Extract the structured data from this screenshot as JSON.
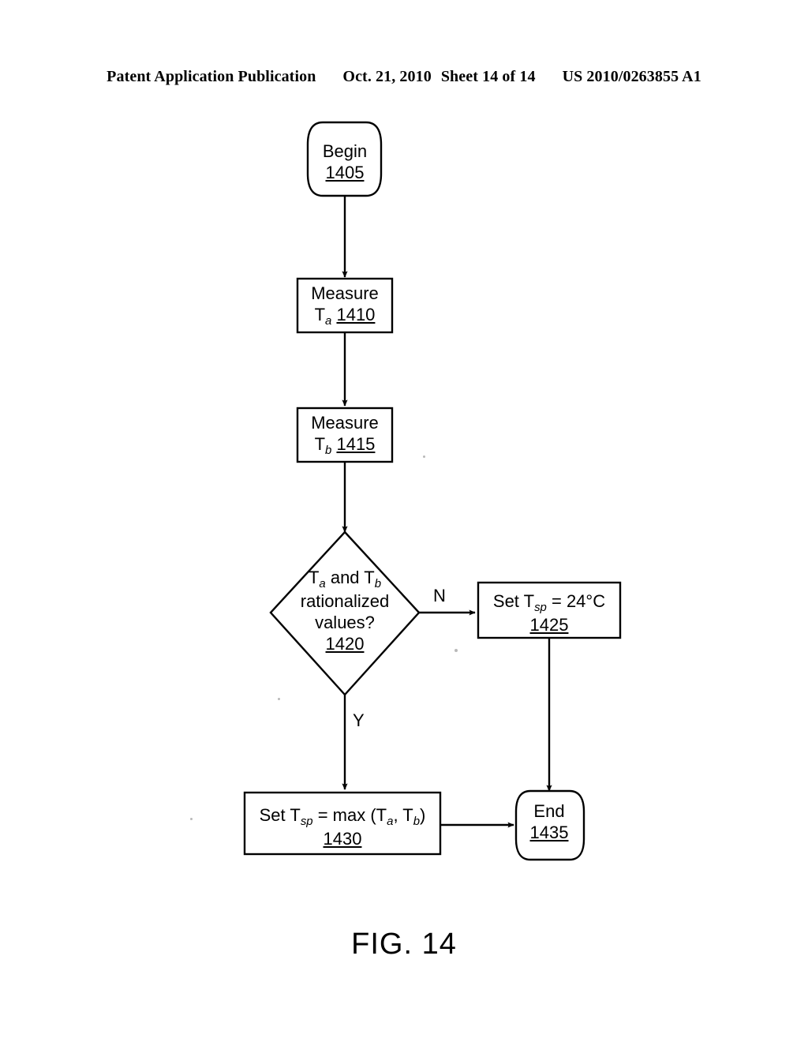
{
  "header": {
    "publication": "Patent Application Publication",
    "date": "Oct. 21, 2010",
    "sheet": "Sheet 14 of 14",
    "patent_number": "US 2010/0263855 A1"
  },
  "figure": {
    "caption": "FIG. 14",
    "line_color": "#000000",
    "background": "#ffffff"
  },
  "flowchart": {
    "nodes": {
      "begin": {
        "shape": "terminator",
        "label": "Begin",
        "ref": "1405"
      },
      "measure_ta": {
        "shape": "process",
        "label": "Measure",
        "var": "T",
        "sub": "a",
        "ref": "1410"
      },
      "measure_tb": {
        "shape": "process",
        "label": "Measure",
        "var": "T",
        "sub": "b",
        "ref": "1415"
      },
      "decision": {
        "shape": "decision",
        "line1_pre": "T",
        "line1_sub1": "a",
        "line1_mid": " and T",
        "line1_sub2": "b",
        "line2": "rationalized",
        "line3": "values?",
        "ref": "1420"
      },
      "set_fixed": {
        "shape": "process",
        "line1_pre": "Set T",
        "line1_sub": "sp",
        "line1_post": " = 24°C",
        "ref": "1425"
      },
      "set_max": {
        "shape": "process",
        "line1_pre": "Set T",
        "line1_sub": "sp",
        "line1_mid": " = max (T",
        "line1_sub2": "a",
        "line1_mid2": ", T",
        "line1_sub3": "b",
        "line1_post": ")",
        "ref": "1430"
      },
      "end": {
        "shape": "terminator",
        "label": "End",
        "ref": "1435"
      }
    },
    "branches": {
      "no_label": "N",
      "yes_label": "Y"
    }
  }
}
